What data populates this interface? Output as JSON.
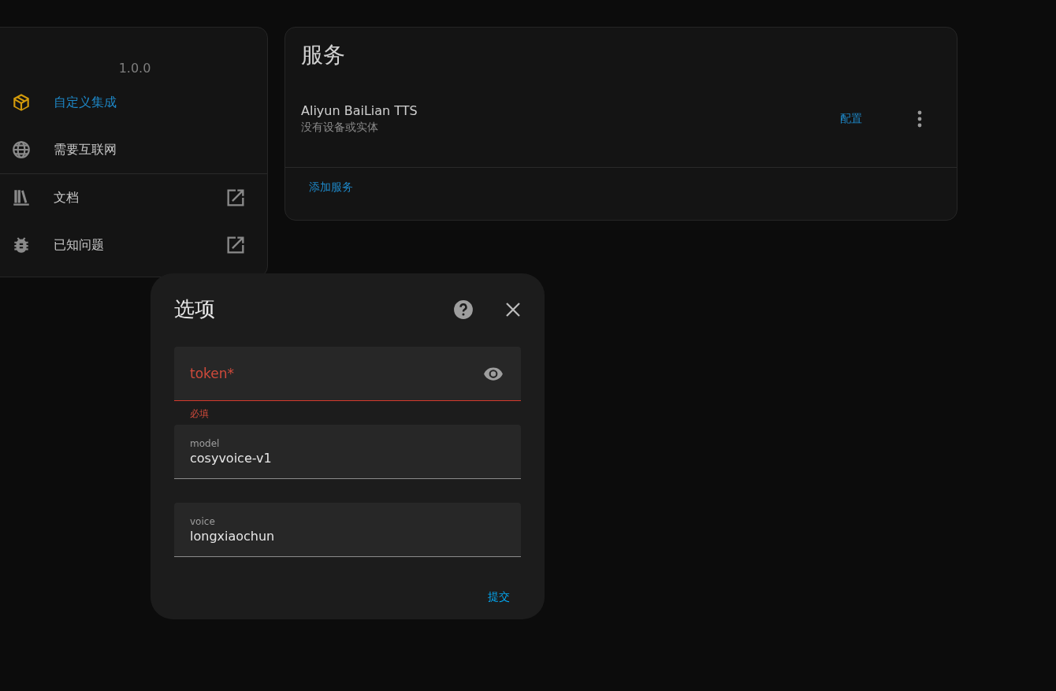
{
  "info_card": {
    "version": "1.0.0",
    "items": [
      {
        "kind": "custom",
        "label": "自定义集成",
        "external": false
      },
      {
        "kind": "internet",
        "label": "需要互联网",
        "external": false
      },
      {
        "kind": "docs",
        "label": "文档",
        "external": true
      },
      {
        "kind": "issues",
        "label": "已知问题",
        "external": true
      }
    ]
  },
  "services_card": {
    "title": "服务",
    "entries": [
      {
        "name": "Aliyun BaiLian TTS",
        "subtitle": "没有设备或实体",
        "action": "配置"
      }
    ],
    "add_button": "添加服务"
  },
  "dialog": {
    "title": "选项",
    "fields": [
      {
        "label": "token*",
        "error": true,
        "helper": "必填",
        "secret": true
      },
      {
        "label": "model",
        "value": "cosyvoice-v1",
        "error": false,
        "secret": false
      },
      {
        "label": "voice",
        "value": "longxiaochun",
        "error": false,
        "secret": false
      }
    ],
    "submit": "提交"
  }
}
